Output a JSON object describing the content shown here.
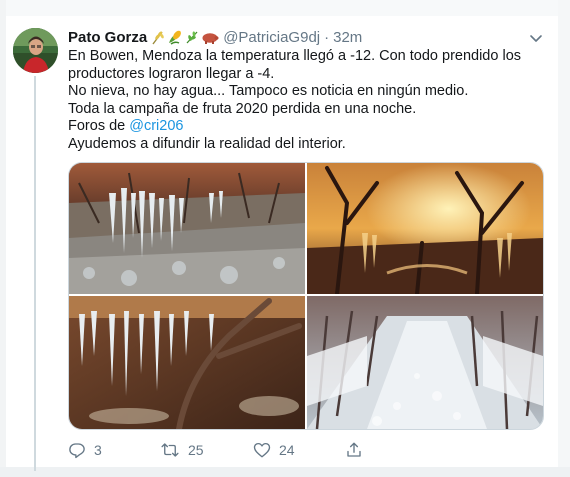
{
  "tweet": {
    "author_name": "Pato Gorza",
    "author_emoji_icons": [
      "wheat-icon",
      "corn-icon",
      "herb-icon",
      "pig-icon"
    ],
    "handle": "@PatriciaG9dj",
    "separator": "·",
    "time": "32m",
    "text_lines": [
      "En Bowen, Mendoza la temperatura llegó a -12. Con todo prendido los",
      "productores lograron llegar a -4.",
      "No nieva, no hay agua... Tampoco es noticia en ningún medio.",
      "Toda la campaña de fruta 2020 perdida en una noche.",
      "Foros de ",
      "Ayudemos a difundir la realidad del interior."
    ],
    "mention": "@cri206",
    "photos": [
      {
        "name": "frozen-vineyard-icicles-photo"
      },
      {
        "name": "sunrise-frosted-trees-photo"
      },
      {
        "name": "icicles-on-branches-photo"
      },
      {
        "name": "frost-covered-orchard-row-photo"
      }
    ]
  },
  "actions": {
    "reply_count": "3",
    "retweet_count": "25",
    "like_count": "24"
  },
  "colors": {
    "text": "#14171a",
    "secondary": "#657786",
    "link": "#1b95e0",
    "border": "#ccd6dd"
  }
}
